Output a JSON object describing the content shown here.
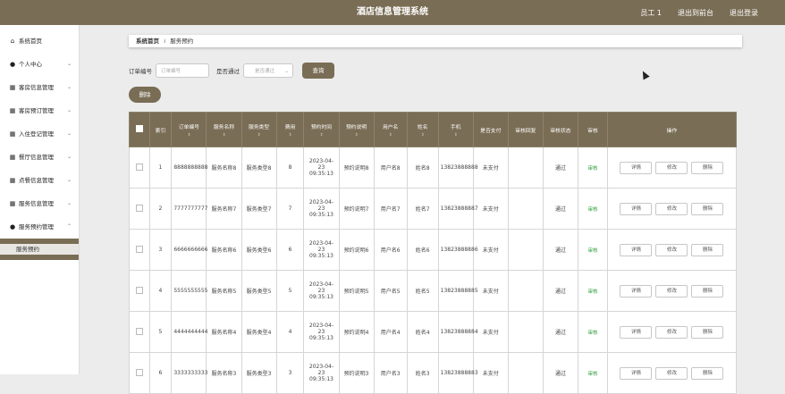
{
  "header": {
    "title": "酒店信息管理系统",
    "user": "员工 1",
    "back_to_admin": "退出到前台",
    "logout": "退出登录"
  },
  "sidebar": {
    "items": [
      {
        "label": "系统首页",
        "icon": "home-icon",
        "glyph": "⌂",
        "has_chevron": false
      },
      {
        "label": "个人中心",
        "icon": "user-icon",
        "glyph": "●",
        "has_chevron": true,
        "chevron": "⌄"
      },
      {
        "label": "客房信息管理",
        "icon": "grid-icon",
        "glyph": "▦",
        "has_chevron": true,
        "chevron": "⌄"
      },
      {
        "label": "客房预订管理",
        "icon": "grid-icon",
        "glyph": "▦",
        "has_chevron": true,
        "chevron": "⌄"
      },
      {
        "label": "入住登记管理",
        "icon": "grid-icon",
        "glyph": "▦",
        "has_chevron": true,
        "chevron": "⌄"
      },
      {
        "label": "餐厅信息管理",
        "icon": "grid-icon",
        "glyph": "▦",
        "has_chevron": true,
        "chevron": "⌄"
      },
      {
        "label": "点餐信息管理",
        "icon": "grid-icon",
        "glyph": "▦",
        "has_chevron": true,
        "chevron": "⌄"
      },
      {
        "label": "服务信息管理",
        "icon": "grid-icon",
        "glyph": "▦",
        "has_chevron": true,
        "chevron": "⌄"
      },
      {
        "label": "服务预约管理",
        "icon": "pin-icon",
        "glyph": "●",
        "has_chevron": true,
        "chevron": "⌃"
      }
    ],
    "sub_item": "服务预约"
  },
  "breadcrumb": {
    "home": "系统首页",
    "separator": "⁞",
    "current": "服务预约"
  },
  "search": {
    "order_label": "订单编号",
    "order_placeholder": "订单编号",
    "pass_label": "是否通过",
    "pass_placeholder": "是否通过",
    "query_button": "查询"
  },
  "delete_button": "删除",
  "table": {
    "sort_glyph": "⇕",
    "columns": [
      "索引",
      "订单编号",
      "服务名称",
      "服务类型",
      "费用",
      "预约时间",
      "预约说明",
      "用户名",
      "姓名",
      "手机",
      "是否支付",
      "审核回复",
      "审核状态",
      "审核",
      "操作"
    ],
    "rows": [
      {
        "index": "1",
        "order": "8888888888",
        "service": "服务名称8",
        "type": "服务类型8",
        "fee": "8",
        "time": "2023-04-23 09:35:13",
        "desc": "预约说明8",
        "username": "用户名8",
        "name": "姓名8",
        "phone": "13823888888",
        "paid": "未支付",
        "reply": "",
        "status": "通过",
        "audit": "审核"
      },
      {
        "index": "2",
        "order": "7777777777",
        "service": "服务名称7",
        "type": "服务类型7",
        "fee": "7",
        "time": "2023-04-23 09:35:13",
        "desc": "预约说明7",
        "username": "用户名7",
        "name": "姓名7",
        "phone": "13823888887",
        "paid": "未支付",
        "reply": "",
        "status": "通过",
        "audit": "审核"
      },
      {
        "index": "3",
        "order": "6666666666",
        "service": "服务名称6",
        "type": "服务类型6",
        "fee": "6",
        "time": "2023-04-23 09:35:13",
        "desc": "预约说明6",
        "username": "用户名6",
        "name": "姓名6",
        "phone": "13823888886",
        "paid": "未支付",
        "reply": "",
        "status": "通过",
        "audit": "审核"
      },
      {
        "index": "4",
        "order": "5555555555",
        "service": "服务名称5",
        "type": "服务类型5",
        "fee": "5",
        "time": "2023-04-23 09:35:13",
        "desc": "预约说明5",
        "username": "用户名5",
        "name": "姓名5",
        "phone": "13823888885",
        "paid": "未支付",
        "reply": "",
        "status": "通过",
        "audit": "审核"
      },
      {
        "index": "5",
        "order": "4444444444",
        "service": "服务名称4",
        "type": "服务类型4",
        "fee": "4",
        "time": "2023-04-23 09:35:13",
        "desc": "预约说明4",
        "username": "用户名4",
        "name": "姓名4",
        "phone": "13823888884",
        "paid": "未支付",
        "reply": "",
        "status": "通过",
        "audit": "审核"
      },
      {
        "index": "6",
        "order": "3333333333",
        "service": "服务名称3",
        "type": "服务类型3",
        "fee": "3",
        "time": "2023-04-23 09:35:13",
        "desc": "预约说明3",
        "username": "用户名3",
        "name": "姓名3",
        "phone": "13823888883",
        "paid": "未支付",
        "reply": "",
        "status": "通过",
        "audit": "审核"
      }
    ],
    "actions": {
      "detail": "详情",
      "edit": "修改",
      "delete": "删除"
    }
  }
}
